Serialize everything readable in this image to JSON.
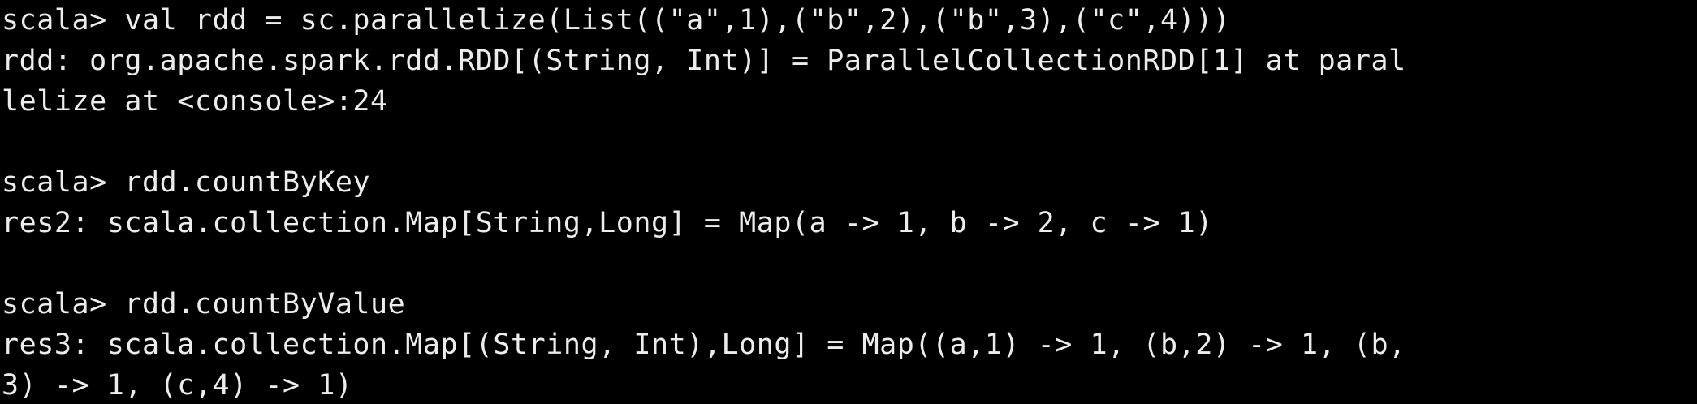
{
  "terminal": {
    "lines": [
      "scala> val rdd = sc.parallelize(List((\"a\",1),(\"b\",2),(\"b\",3),(\"c\",4)))",
      "rdd: org.apache.spark.rdd.RDD[(String, Int)] = ParallelCollectionRDD[1] at paral",
      "lelize at <console>:24",
      "",
      "scala> rdd.countByKey",
      "res2: scala.collection.Map[String,Long] = Map(a -> 1, b -> 2, c -> 1)",
      "",
      "scala> rdd.countByValue",
      "res3: scala.collection.Map[(String, Int),Long] = Map((a,1) -> 1, (b,2) -> 1, (b,",
      "3) -> 1, (c,4) -> 1)"
    ]
  }
}
